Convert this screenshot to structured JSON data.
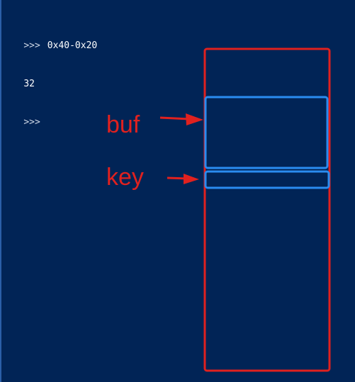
{
  "console": {
    "lines": [
      {
        "prompt": ">>>",
        "text": "0x40-0x20"
      },
      {
        "prompt": "",
        "text": "32"
      },
      {
        "prompt": ">>>",
        "text": ""
      }
    ]
  },
  "annotation": {
    "labels": {
      "buf": "buf",
      "key": "key"
    },
    "colors": {
      "stack_outline": "#e0211f",
      "region_outline": "#2a8cf0",
      "arrow": "#e0211f",
      "background": "#012456"
    }
  }
}
